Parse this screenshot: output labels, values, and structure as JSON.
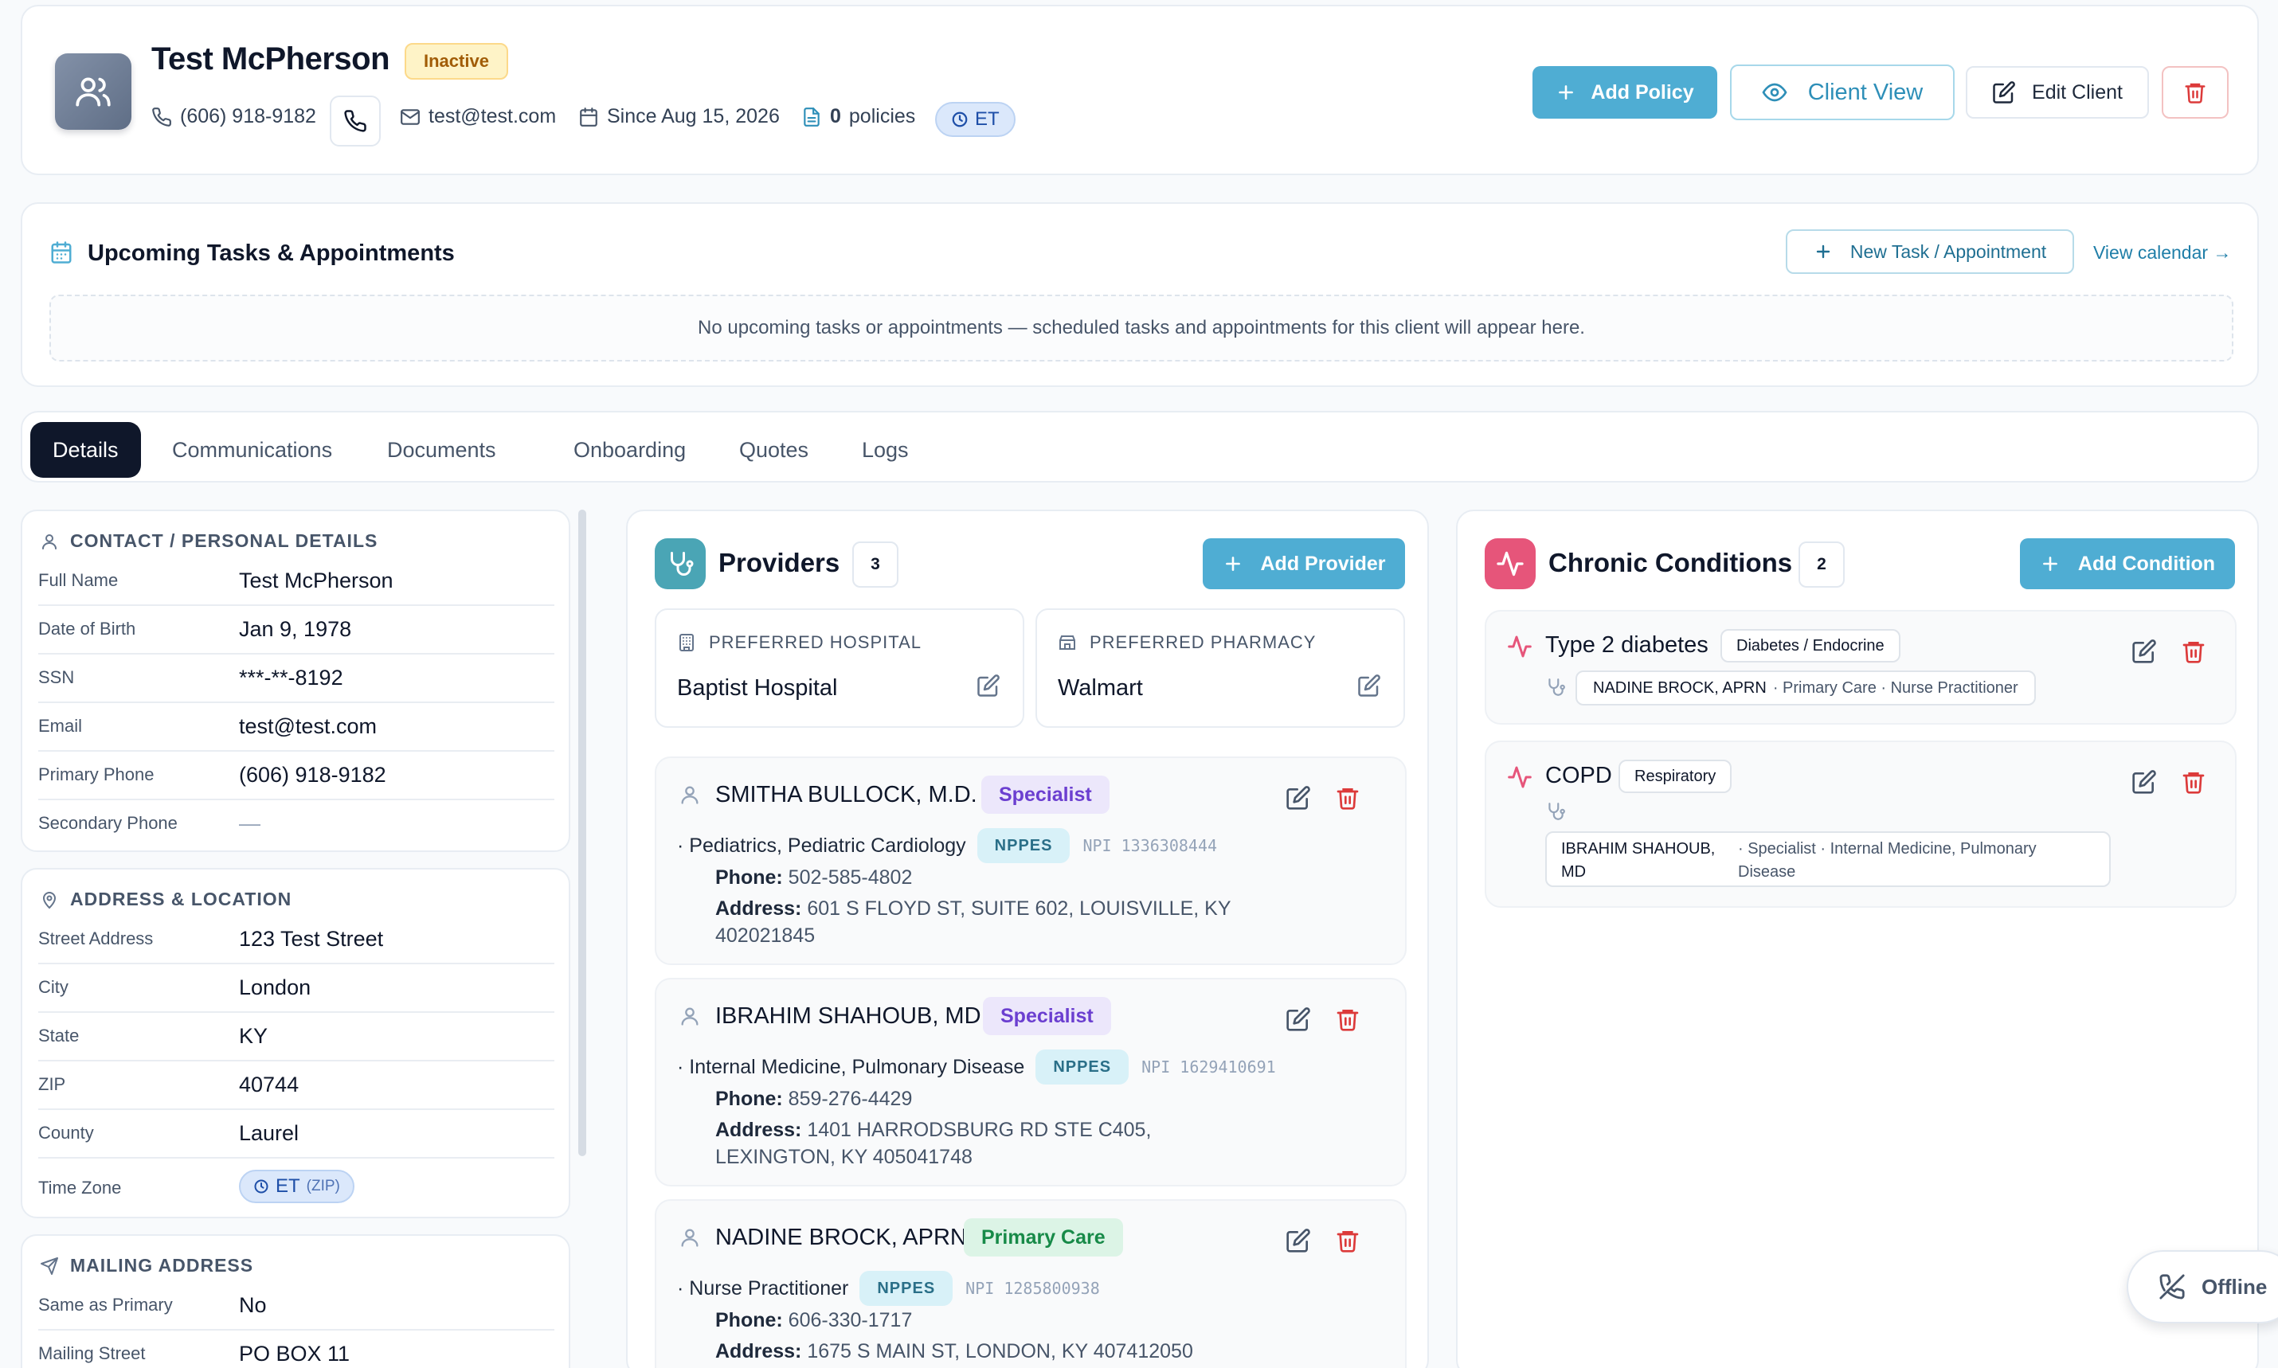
{
  "client": {
    "name": "Test McPherson",
    "status": "Inactive",
    "phone": "(606) 918-9182",
    "email": "test@test.com",
    "since": "Since Aug 15, 2026",
    "policies_count": "0",
    "policies_label": "policies",
    "timezone": "ET"
  },
  "header_actions": {
    "add_policy": "Add Policy",
    "client_view": "Client View",
    "edit_client": "Edit Client"
  },
  "tasks": {
    "title": "Upcoming Tasks & Appointments",
    "new_button": "New Task / Appointment",
    "view_calendar": "View calendar →",
    "empty_message": "No upcoming tasks or appointments — scheduled tasks and appointments for this client will appear here."
  },
  "tabs": [
    {
      "label": "Details",
      "active": true
    },
    {
      "label": "Communications"
    },
    {
      "label": "Documents"
    },
    {
      "label": "Onboarding"
    },
    {
      "label": "Quotes"
    },
    {
      "label": "Logs"
    }
  ],
  "contact": {
    "title": "CONTACT / PERSONAL DETAILS",
    "fields": [
      {
        "label": "Full Name",
        "value": "Test McPherson"
      },
      {
        "label": "Date of Birth",
        "value": "Jan 9, 1978"
      },
      {
        "label": "SSN",
        "value": "***-**-8192"
      },
      {
        "label": "Email",
        "value": "test@test.com"
      },
      {
        "label": "Primary Phone",
        "value": "(606) 918-9182"
      },
      {
        "label": "Secondary Phone",
        "value": "—"
      }
    ]
  },
  "address": {
    "title": "ADDRESS & LOCATION",
    "fields": [
      {
        "label": "Street Address",
        "value": "123 Test Street"
      },
      {
        "label": "City",
        "value": "London"
      },
      {
        "label": "State",
        "value": "KY"
      },
      {
        "label": "ZIP",
        "value": "40744"
      },
      {
        "label": "County",
        "value": "Laurel"
      },
      {
        "label": "Time Zone",
        "value": "ET",
        "suffix": "(ZIP)"
      }
    ]
  },
  "mailing": {
    "title": "MAILING ADDRESS",
    "fields": [
      {
        "label": "Same as Primary",
        "value": "No"
      },
      {
        "label": "Mailing Street",
        "value": "PO BOX 11"
      }
    ]
  },
  "providers": {
    "title": "Providers",
    "count": "3",
    "add_button": "Add Provider",
    "preferred_hospital": {
      "label": "PREFERRED HOSPITAL",
      "value": "Baptist Hospital"
    },
    "preferred_pharmacy": {
      "label": "PREFERRED PHARMACY",
      "value": "Walmart"
    },
    "phone_label": "Phone:",
    "address_label": "Address:",
    "items": [
      {
        "name": "SMITHA BULLOCK, M.D.",
        "role": "Specialist",
        "specialty": "· Pediatrics, Pediatric Cardiology",
        "source": "NPPES",
        "npi": "NPI 1336308444",
        "phone": "502-585-4802",
        "address": "601 S FLOYD ST, SUITE 602, LOUISVILLE, KY 402021845"
      },
      {
        "name": "IBRAHIM SHAHOUB, MD",
        "role": "Specialist",
        "specialty": "· Internal Medicine, Pulmonary Disease",
        "source": "NPPES",
        "npi": "NPI 1629410691",
        "phone": "859-276-4429",
        "address": "1401 HARRODSBURG RD STE C405, LEXINGTON, KY 405041748"
      },
      {
        "name": "NADINE BROCK, APRN",
        "role": "Primary Care",
        "specialty": "· Nurse Practitioner",
        "source": "NPPES",
        "npi": "NPI 1285800938",
        "phone": "606-330-1717",
        "address": "1675 S MAIN ST, LONDON, KY 407412050"
      }
    ]
  },
  "conditions": {
    "title": "Chronic Conditions",
    "count": "2",
    "add_button": "Add Condition",
    "items": [
      {
        "name": "Type 2 diabetes",
        "category": "Diabetes / Endocrine",
        "provider_name": "NADINE BROCK, APRN",
        "provider_detail": "· Primary Care · Nurse Practitioner"
      },
      {
        "name": "COPD",
        "category": "Respiratory",
        "provider_name": "IBRAHIM SHAHOUB, MD",
        "provider_detail": "· Specialist · Internal Medicine, Pulmonary Disease"
      }
    ]
  },
  "connection": {
    "status": "Offline"
  },
  "colors": {
    "accent": "#4fadd3",
    "danger": "#dc3a3a",
    "providers_icon_bg": "#4aa5b5",
    "conditions_icon_bg": "#e6557a"
  }
}
